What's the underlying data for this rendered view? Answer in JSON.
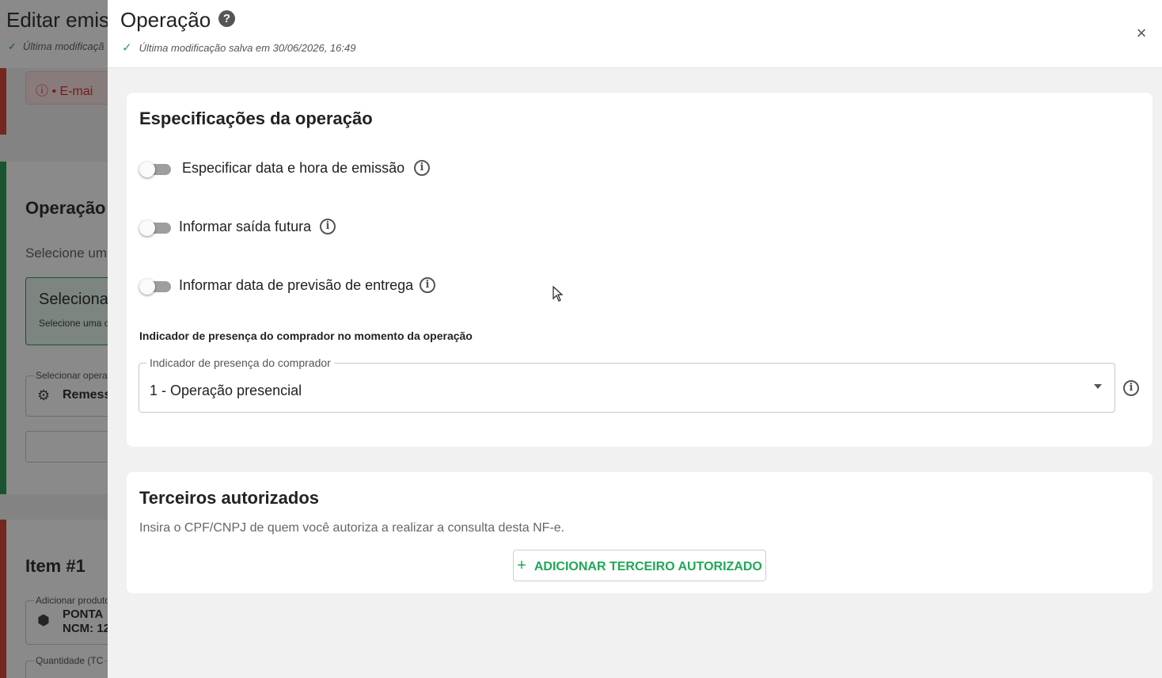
{
  "background": {
    "title": "Editar emis",
    "saved_text": "Última modificaçã",
    "alert_text": "E-mai",
    "section_title": "Operação",
    "section_subtitle": "Selecione um",
    "selected_box_title": "Seleciona",
    "selected_box_sub": "Selecione uma o",
    "operation_field_label": "Selecionar operaç",
    "operation_field_value": "Remess",
    "item_title": "Item #1",
    "product_field_label": "Adicionar produto",
    "product_line1": "PONTA",
    "product_line2": "NCM: 12",
    "quantity_label": "Quantidade (TC"
  },
  "drawer": {
    "title": "Operação",
    "saved": "Última modificação salva em 30/06/2026, 16:49",
    "close": "×"
  },
  "specs": {
    "title": "Especificações da operação",
    "toggles": [
      {
        "label": "Especificar data e hora de emissão",
        "checked": false
      },
      {
        "label": "Informar saída futura",
        "checked": false
      },
      {
        "label": "Informar data de previsão de entrega",
        "checked": false
      }
    ],
    "presence_section_label": "Indicador de presença do comprador no momento da operação",
    "presence_field_label": "Indicador de presença do comprador",
    "presence_field_value": "1 - Operação presencial"
  },
  "third_parties": {
    "title": "Terceiros autorizados",
    "subtitle": "Insira o CPF/CNPJ de quem você autoriza a realizar a consulta desta NF-e.",
    "add_button": "ADICIONAR TERCEIRO AUTORIZADO"
  },
  "colors": {
    "accent_green": "#1fa857",
    "error_red": "#d9463d"
  }
}
